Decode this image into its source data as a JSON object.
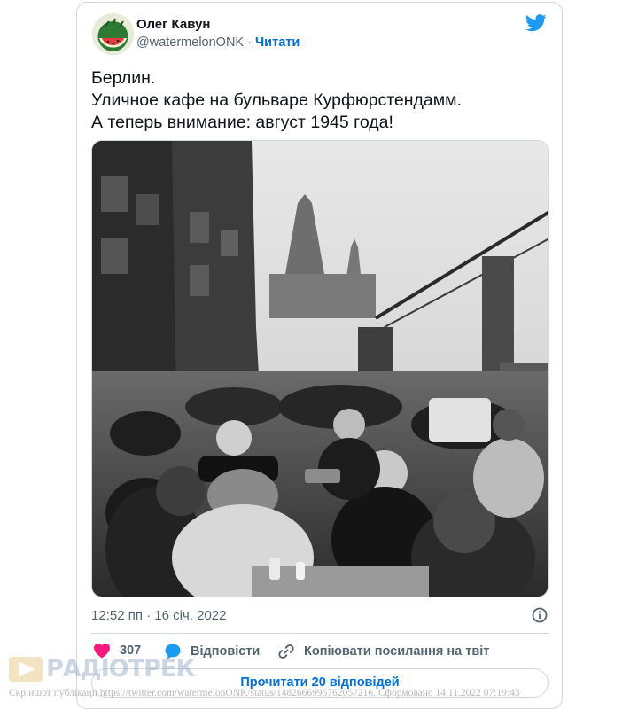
{
  "author": {
    "name": "Олег Кавун",
    "handle": "@watermelonONK",
    "separator": " · ",
    "follow_label": "Читати"
  },
  "tweet": {
    "lines": [
      "Берлин.",
      "Уличное кафе на бульваре Курфюрстендамм.",
      "А теперь внимание: август 1945 года!"
    ],
    "timestamp": "12:52 пп · 16 січ. 2022"
  },
  "actions": {
    "likes_count": "307",
    "reply_label": "Відповісти",
    "copy_link_label": "Копіювати посилання на твіт"
  },
  "read_replies_label": "Прочитати 20 відповідей",
  "watermark": {
    "text": "РАДІОТРЕК"
  },
  "footer_note": "Скріншот публікації https://twitter.com/watermelonONK/status/1482666995762057216. Сформовано 14.11.2022 07:19:43",
  "colors": {
    "accent_blue": "#006fd6",
    "twitter_blue": "#1d9bf0",
    "like_pink": "#f91880",
    "muted_text": "#536471",
    "border": "#cfd9de"
  },
  "icons": {
    "brand": "twitter-bird-icon",
    "like": "heart-icon",
    "reply": "speech-bubble-icon",
    "copy_link": "link-icon",
    "info": "info-icon"
  }
}
